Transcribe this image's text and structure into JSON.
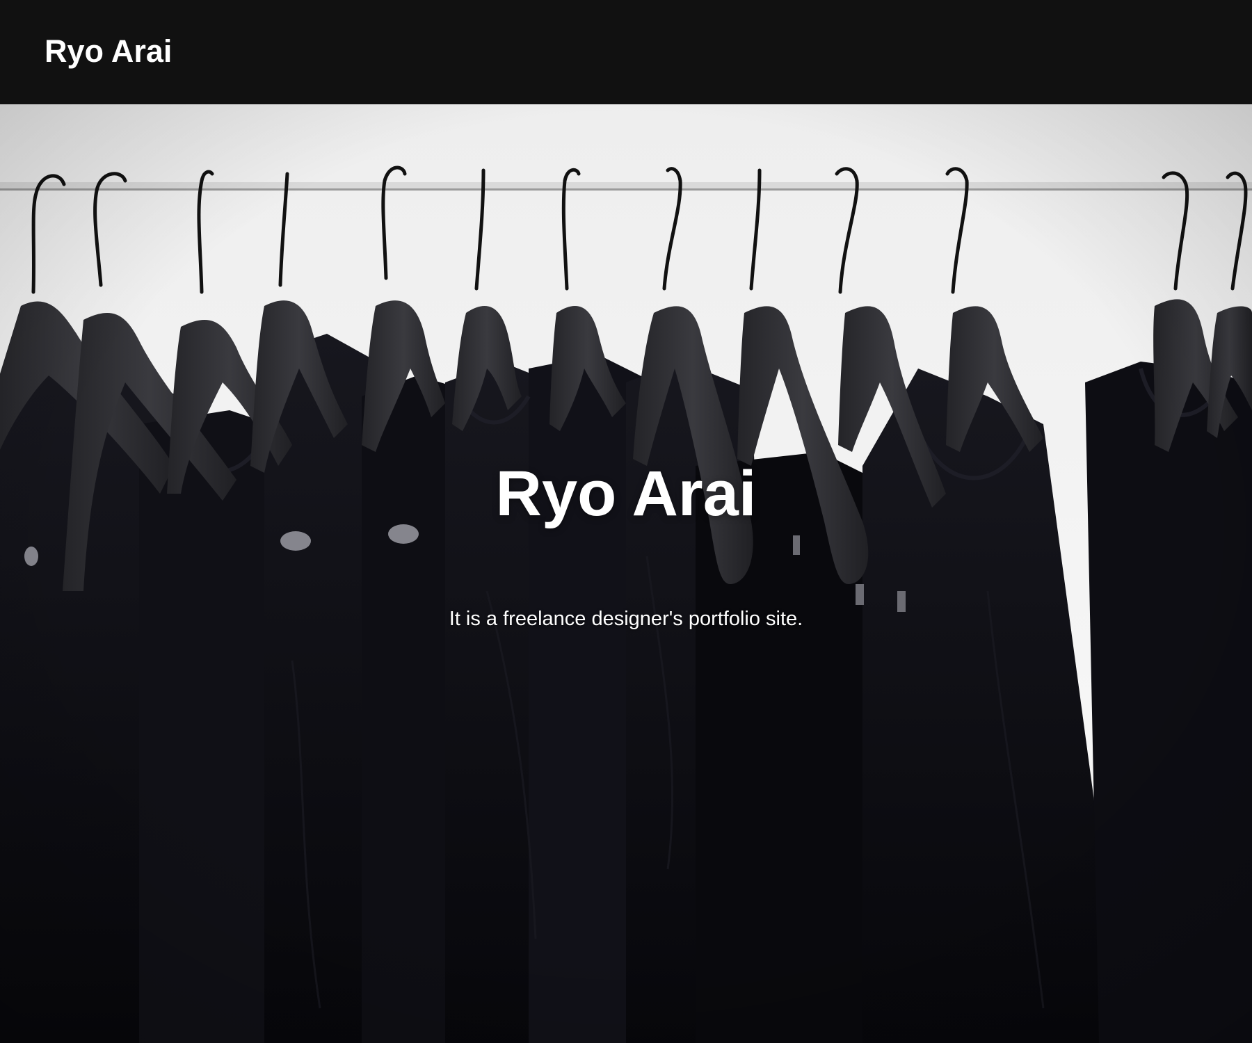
{
  "header": {
    "brand": "Ryo Arai"
  },
  "hero": {
    "title": "Ryo Arai",
    "tagline": "It is a freelance designer's portfolio site.",
    "background_image": "clothes-on-hangers-photo"
  },
  "colors": {
    "header_background": "#111111",
    "text": "#ffffff",
    "wall": "#f2f2f2",
    "garment": "#0c0c12",
    "hanger": "#2b2b2f"
  }
}
